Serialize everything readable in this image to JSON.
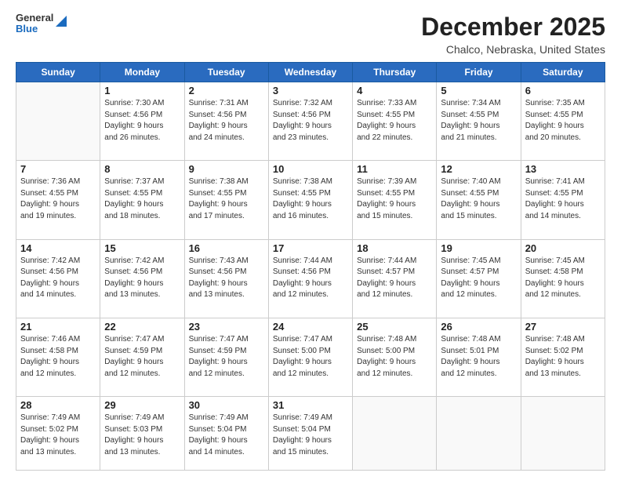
{
  "header": {
    "logo_general": "General",
    "logo_blue": "Blue",
    "title": "December 2025",
    "location": "Chalco, Nebraska, United States"
  },
  "days_of_week": [
    "Sunday",
    "Monday",
    "Tuesday",
    "Wednesday",
    "Thursday",
    "Friday",
    "Saturday"
  ],
  "weeks": [
    [
      {
        "day": "",
        "info": ""
      },
      {
        "day": "1",
        "info": "Sunrise: 7:30 AM\nSunset: 4:56 PM\nDaylight: 9 hours\nand 26 minutes."
      },
      {
        "day": "2",
        "info": "Sunrise: 7:31 AM\nSunset: 4:56 PM\nDaylight: 9 hours\nand 24 minutes."
      },
      {
        "day": "3",
        "info": "Sunrise: 7:32 AM\nSunset: 4:56 PM\nDaylight: 9 hours\nand 23 minutes."
      },
      {
        "day": "4",
        "info": "Sunrise: 7:33 AM\nSunset: 4:55 PM\nDaylight: 9 hours\nand 22 minutes."
      },
      {
        "day": "5",
        "info": "Sunrise: 7:34 AM\nSunset: 4:55 PM\nDaylight: 9 hours\nand 21 minutes."
      },
      {
        "day": "6",
        "info": "Sunrise: 7:35 AM\nSunset: 4:55 PM\nDaylight: 9 hours\nand 20 minutes."
      }
    ],
    [
      {
        "day": "7",
        "info": "Sunrise: 7:36 AM\nSunset: 4:55 PM\nDaylight: 9 hours\nand 19 minutes."
      },
      {
        "day": "8",
        "info": "Sunrise: 7:37 AM\nSunset: 4:55 PM\nDaylight: 9 hours\nand 18 minutes."
      },
      {
        "day": "9",
        "info": "Sunrise: 7:38 AM\nSunset: 4:55 PM\nDaylight: 9 hours\nand 17 minutes."
      },
      {
        "day": "10",
        "info": "Sunrise: 7:38 AM\nSunset: 4:55 PM\nDaylight: 9 hours\nand 16 minutes."
      },
      {
        "day": "11",
        "info": "Sunrise: 7:39 AM\nSunset: 4:55 PM\nDaylight: 9 hours\nand 15 minutes."
      },
      {
        "day": "12",
        "info": "Sunrise: 7:40 AM\nSunset: 4:55 PM\nDaylight: 9 hours\nand 15 minutes."
      },
      {
        "day": "13",
        "info": "Sunrise: 7:41 AM\nSunset: 4:55 PM\nDaylight: 9 hours\nand 14 minutes."
      }
    ],
    [
      {
        "day": "14",
        "info": "Sunrise: 7:42 AM\nSunset: 4:56 PM\nDaylight: 9 hours\nand 14 minutes."
      },
      {
        "day": "15",
        "info": "Sunrise: 7:42 AM\nSunset: 4:56 PM\nDaylight: 9 hours\nand 13 minutes."
      },
      {
        "day": "16",
        "info": "Sunrise: 7:43 AM\nSunset: 4:56 PM\nDaylight: 9 hours\nand 13 minutes."
      },
      {
        "day": "17",
        "info": "Sunrise: 7:44 AM\nSunset: 4:56 PM\nDaylight: 9 hours\nand 12 minutes."
      },
      {
        "day": "18",
        "info": "Sunrise: 7:44 AM\nSunset: 4:57 PM\nDaylight: 9 hours\nand 12 minutes."
      },
      {
        "day": "19",
        "info": "Sunrise: 7:45 AM\nSunset: 4:57 PM\nDaylight: 9 hours\nand 12 minutes."
      },
      {
        "day": "20",
        "info": "Sunrise: 7:45 AM\nSunset: 4:58 PM\nDaylight: 9 hours\nand 12 minutes."
      }
    ],
    [
      {
        "day": "21",
        "info": "Sunrise: 7:46 AM\nSunset: 4:58 PM\nDaylight: 9 hours\nand 12 minutes."
      },
      {
        "day": "22",
        "info": "Sunrise: 7:47 AM\nSunset: 4:59 PM\nDaylight: 9 hours\nand 12 minutes."
      },
      {
        "day": "23",
        "info": "Sunrise: 7:47 AM\nSunset: 4:59 PM\nDaylight: 9 hours\nand 12 minutes."
      },
      {
        "day": "24",
        "info": "Sunrise: 7:47 AM\nSunset: 5:00 PM\nDaylight: 9 hours\nand 12 minutes."
      },
      {
        "day": "25",
        "info": "Sunrise: 7:48 AM\nSunset: 5:00 PM\nDaylight: 9 hours\nand 12 minutes."
      },
      {
        "day": "26",
        "info": "Sunrise: 7:48 AM\nSunset: 5:01 PM\nDaylight: 9 hours\nand 12 minutes."
      },
      {
        "day": "27",
        "info": "Sunrise: 7:48 AM\nSunset: 5:02 PM\nDaylight: 9 hours\nand 13 minutes."
      }
    ],
    [
      {
        "day": "28",
        "info": "Sunrise: 7:49 AM\nSunset: 5:02 PM\nDaylight: 9 hours\nand 13 minutes."
      },
      {
        "day": "29",
        "info": "Sunrise: 7:49 AM\nSunset: 5:03 PM\nDaylight: 9 hours\nand 13 minutes."
      },
      {
        "day": "30",
        "info": "Sunrise: 7:49 AM\nSunset: 5:04 PM\nDaylight: 9 hours\nand 14 minutes."
      },
      {
        "day": "31",
        "info": "Sunrise: 7:49 AM\nSunset: 5:04 PM\nDaylight: 9 hours\nand 15 minutes."
      },
      {
        "day": "",
        "info": ""
      },
      {
        "day": "",
        "info": ""
      },
      {
        "day": "",
        "info": ""
      }
    ]
  ]
}
